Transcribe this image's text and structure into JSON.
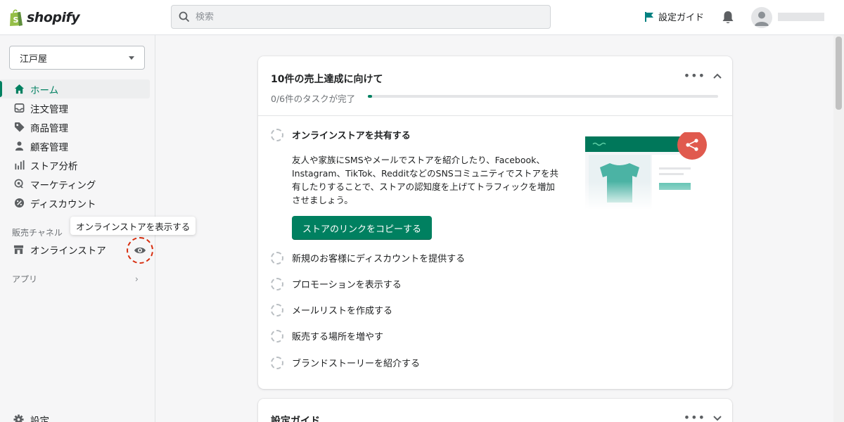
{
  "brand": {
    "logo_text": "shopify",
    "accent": "#008060"
  },
  "topbar": {
    "search_placeholder": "検索",
    "setup_guide_label": "設定ガイド"
  },
  "sidebar": {
    "store_name": "江戸屋",
    "nav_items": [
      {
        "label": "ホーム",
        "icon": "home-icon",
        "active": true
      },
      {
        "label": "注文管理",
        "icon": "inbox-icon"
      },
      {
        "label": "商品管理",
        "icon": "tag-icon"
      },
      {
        "label": "顧客管理",
        "icon": "person-icon"
      },
      {
        "label": "ストア分析",
        "icon": "analytics-icon"
      },
      {
        "label": "マーケティング",
        "icon": "target-icon"
      },
      {
        "label": "ディスカウント",
        "icon": "discount-icon"
      }
    ],
    "sales_channels_label": "販売チャネル",
    "online_store_label": "オンラインストア",
    "tooltip": "オンラインストアを表示する",
    "apps_label": "アプリ",
    "settings_label": "設定"
  },
  "card": {
    "title": "10件の売上達成に向けて",
    "progress_text": "0/6件のタスクが完了",
    "progress_fraction": 0.01,
    "tasks": [
      "オンラインストアを共有する",
      "新規のお客様にディスカウントを提供する",
      "プロモーションを表示する",
      "メールリストを作成する",
      "販売する場所を増やす",
      "ブランドストーリーを紹介する"
    ],
    "share_description": "友人や家族にSMSやメールでストアを紹介したり、Facebook、Instagram、TikTok、RedditなどのSNSコミュニティでストアを共有したりすることで、ストアの認知度を上げてトラフィックを増加させましょう。",
    "copy_button": "ストアのリンクをコピーする"
  },
  "card2": {
    "title": "設定ガイド"
  }
}
